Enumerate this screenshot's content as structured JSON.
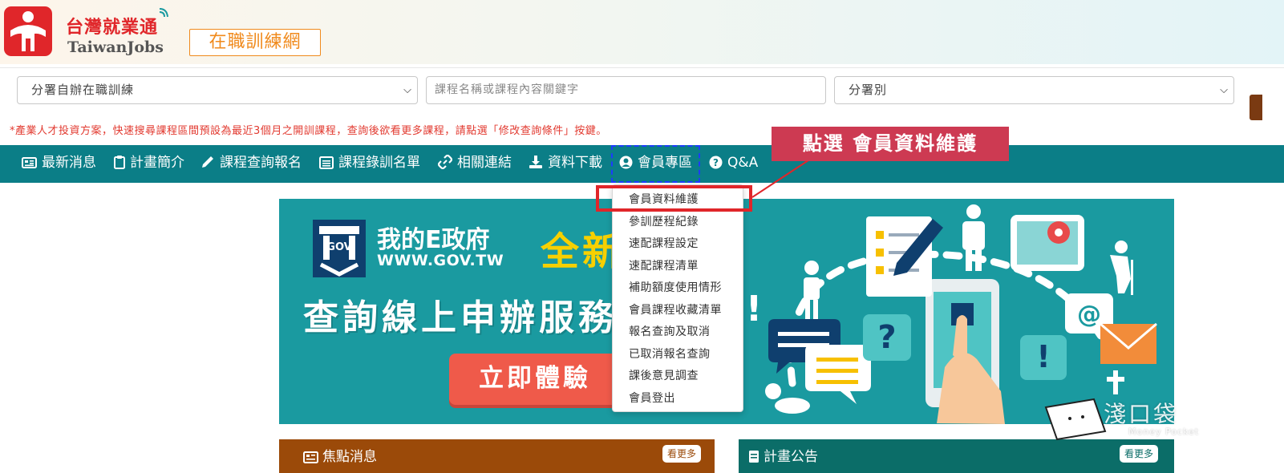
{
  "header": {
    "logo_cn": "台灣就業通",
    "logo_en": "TaiwanJobs",
    "site_badge": "在職訓練網"
  },
  "search": {
    "program_select": "分署自辦在職訓練",
    "keyword_placeholder": "課程名稱或課程內容關鍵字",
    "branch_select": "分署別",
    "notice": "*產業人才投資方案，快速搜尋課程區間預設為最近3個月之開訓課程，查詢後欲看更多課程，請點選「修改查詢條件」按鍵。"
  },
  "nav": {
    "items": [
      {
        "label": "最新消息",
        "icon": "newspaper-icon"
      },
      {
        "label": "計畫簡介",
        "icon": "clipboard-icon"
      },
      {
        "label": "課程查詢報名",
        "icon": "pencil-icon"
      },
      {
        "label": "課程錄訓名單",
        "icon": "list-icon"
      },
      {
        "label": "相關連結",
        "icon": "link-icon"
      },
      {
        "label": "資料下載",
        "icon": "download-icon"
      },
      {
        "label": "會員專區",
        "icon": "user-circle-icon"
      },
      {
        "label": "Q&A",
        "icon": "question-circle-icon"
      }
    ]
  },
  "member_menu": {
    "items": [
      "會員資料維護",
      "參訓歷程紀錄",
      "速配課程設定",
      "速配課程清單",
      "補助額度使用情形",
      "會員課程收藏清單",
      "報名查詢及取消",
      "已取消報名查詢",
      "課後意見調查",
      "會員登出"
    ]
  },
  "callout": "點選 會員資料維護",
  "banner": {
    "gov_name": "我的E政府",
    "gov_url": "WWW.GOV.TW",
    "gov_logo_label": "GOV",
    "new_tag": "全新",
    "headline": "查詢線上申辦服務",
    "bang": "!",
    "cta": "立即體驗"
  },
  "panels": {
    "news_title": "焦點消息",
    "news_more": "看更多",
    "plan_title": "計畫公告",
    "plan_more": "看更多"
  },
  "watermark": {
    "text": "淺口袋",
    "sub": "Money Pocket"
  },
  "colors": {
    "nav_bg": "#0b7e87",
    "brand_red": "#e0262a",
    "badge_orange": "#f08a1c",
    "callout_bg": "#cd3a52",
    "banner_teal": "#1a9aa0",
    "news_panel": "#9b4a09",
    "plan_panel": "#0b6d68"
  }
}
